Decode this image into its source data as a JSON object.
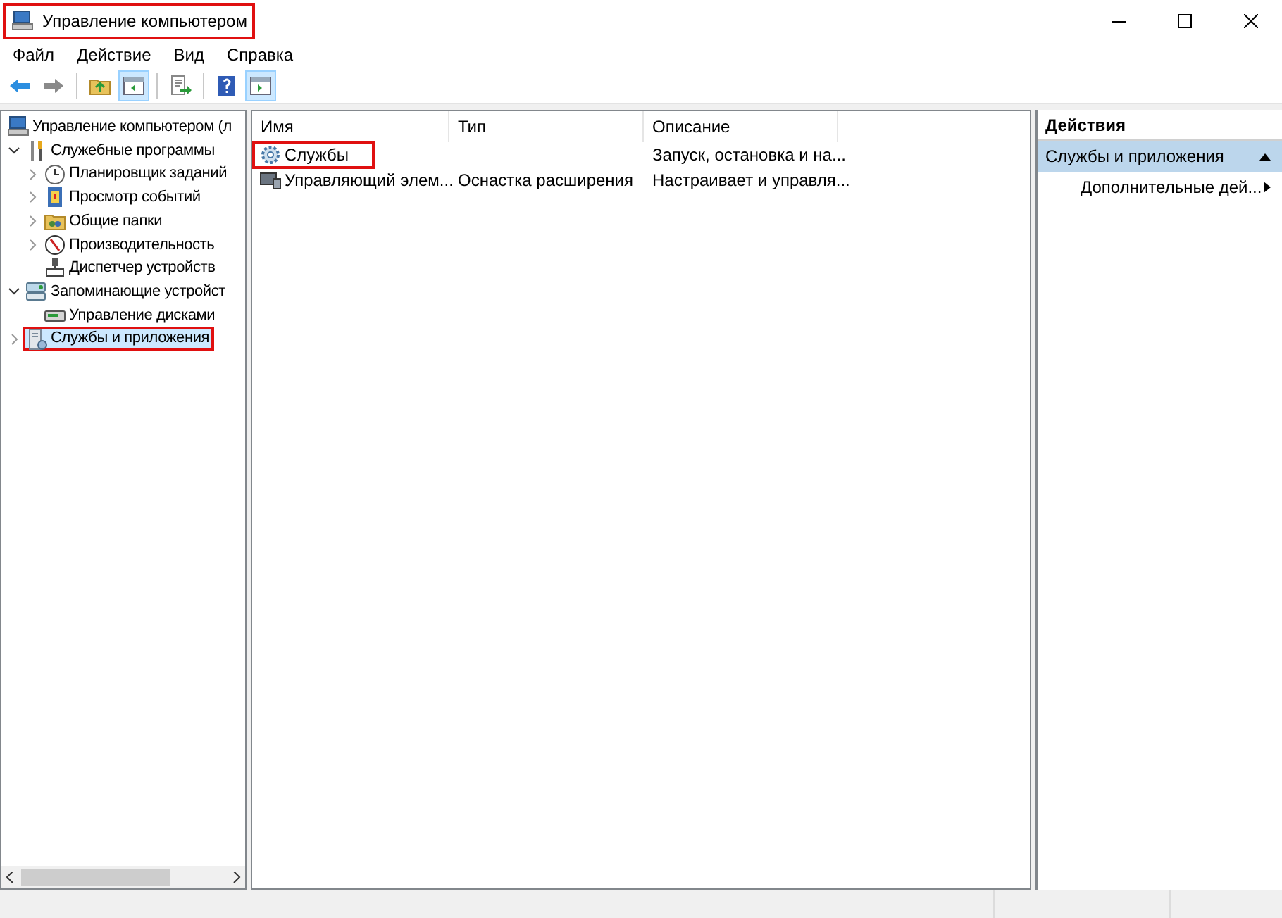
{
  "window": {
    "title": "Управление компьютером",
    "title_highlighted": true
  },
  "menu": [
    "Файл",
    "Действие",
    "Вид",
    "Справка"
  ],
  "toolbar": [
    {
      "kind": "back",
      "pressed": false
    },
    {
      "kind": "forward",
      "pressed": false
    },
    {
      "kind": "sep"
    },
    {
      "kind": "up",
      "pressed": false
    },
    {
      "kind": "tree",
      "pressed": true
    },
    {
      "kind": "sep"
    },
    {
      "kind": "export",
      "pressed": false
    },
    {
      "kind": "sep"
    },
    {
      "kind": "help",
      "pressed": false
    },
    {
      "kind": "pane",
      "pressed": true
    }
  ],
  "tree": [
    {
      "label": "Управление компьютером (л",
      "kind": "computer",
      "selected": false,
      "highlighted": false,
      "children": [
        {
          "label": "Служебные программы",
          "kind": "tools",
          "expanded": true,
          "selected": false,
          "highlighted": false,
          "children": [
            {
              "label": "Планировщик заданий",
              "kind": "clock",
              "expanded": false,
              "has_children": true,
              "selected": false,
              "highlighted": false
            },
            {
              "label": "Просмотр событий",
              "kind": "log",
              "expanded": false,
              "has_children": true,
              "selected": false,
              "highlighted": false
            },
            {
              "label": "Общие папки",
              "kind": "folder",
              "expanded": false,
              "has_children": true,
              "selected": false,
              "highlighted": false
            },
            {
              "label": "Производительность",
              "kind": "perf",
              "expanded": false,
              "has_children": true,
              "selected": false,
              "highlighted": false
            },
            {
              "label": "Диспетчер устройств",
              "kind": "device",
              "expanded": false,
              "has_children": false,
              "selected": false,
              "highlighted": false
            }
          ]
        },
        {
          "label": "Запоминающие устройст",
          "kind": "storage",
          "expanded": true,
          "selected": false,
          "highlighted": false,
          "children": [
            {
              "label": "Управление дисками",
              "kind": "disk",
              "expanded": false,
              "has_children": false,
              "selected": false,
              "highlighted": false
            }
          ]
        },
        {
          "label": "Службы и приложения",
          "kind": "services",
          "expanded": false,
          "has_children": true,
          "selected": true,
          "highlighted": true
        }
      ]
    }
  ],
  "table": {
    "columns": [
      "Имя",
      "Тип",
      "Описание"
    ],
    "rows": [
      {
        "kind": "gear",
        "cells": [
          "Службы",
          "",
          "Запуск, остановка и на..."
        ],
        "highlighted": true
      },
      {
        "kind": "wmi",
        "cells": [
          "Управляющий элем...",
          "Оснастка расширения",
          "Настраивает и управля..."
        ],
        "highlighted": false
      }
    ]
  },
  "actions": {
    "title": "Действия",
    "section": "Службы и приложения",
    "items": [
      "Дополнительные дей..."
    ]
  }
}
